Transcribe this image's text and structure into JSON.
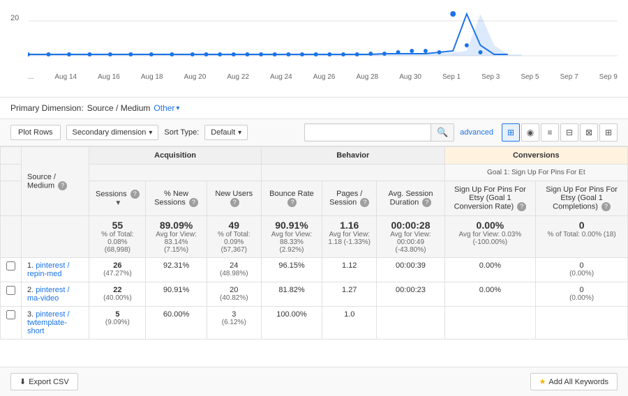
{
  "chart": {
    "y_label": "20",
    "x_labels": [
      "...",
      "Aug 14",
      "Aug 16",
      "Aug 18",
      "Aug 20",
      "Aug 22",
      "Aug 24",
      "Aug 26",
      "Aug 28",
      "Aug 30",
      "Sep 1",
      "Sep 3",
      "Sep 5",
      "Sep 7",
      "Sep 9"
    ]
  },
  "primary_dimension": {
    "label": "Primary Dimension:",
    "value": "Source / Medium",
    "other_label": "Other"
  },
  "toolbar": {
    "plot_rows": "Plot Rows",
    "secondary_dimension": "Secondary dimension",
    "sort_type_label": "Sort Type:",
    "sort_default": "Default",
    "search_placeholder": "",
    "advanced_label": "advanced",
    "view_icons": [
      "⊞",
      "◉",
      "≡",
      "⊟",
      "⊠",
      "⊞"
    ]
  },
  "table": {
    "headers": {
      "source_medium": "Source / Medium",
      "acquisition_group": "Acquisition",
      "behavior_group": "Behavior",
      "conversions_group": "Conversions",
      "goal_label": "Goal 1: Sign Up For Pins For Et",
      "sessions": "Sessions",
      "pct_new_sessions": "% New Sessions",
      "new_users": "New Users",
      "bounce_rate": "Bounce Rate",
      "pages_session": "Pages / Session",
      "avg_session_duration": "Avg. Session Duration",
      "sign_up_rate": "Sign Up For Pins For Etsy (Goal 1 Conversion Rate)",
      "sign_up_completions": "Sign Up For Pins For Etsy (Goal 1 Completions)"
    },
    "total_row": {
      "sessions": "55",
      "sessions_sub": "% of Total: 0.08% (68,998)",
      "pct_new_sessions": "89.09%",
      "pct_new_sessions_sub": "Avg for View: 83.14% (7.15%)",
      "new_users": "49",
      "new_users_sub": "% of Total: 0.09% (57,367)",
      "bounce_rate": "90.91%",
      "bounce_rate_sub": "Avg for View: 88.33% (2.92%)",
      "pages_session": "1.16",
      "pages_session_sub": "Avg for View: 1.18 (-1.33%)",
      "avg_session_duration": "00:00:28",
      "avg_session_duration_sub": "Avg for View: 00:00:49 (-43.80%)",
      "sign_up_rate": "0.00%",
      "sign_up_rate_sub": "Avg for View: 0.03% (-100.00%)",
      "sign_up_completions": "0",
      "sign_up_completions_sub": "% of Total: 0.00% (18)"
    },
    "rows": [
      {
        "num": "1.",
        "source": "pinterest / repin-med",
        "sessions": "26",
        "sessions_sub": "(47.27%)",
        "pct_new_sessions": "92.31%",
        "new_users": "24",
        "new_users_sub": "(48.98%)",
        "bounce_rate": "96.15%",
        "pages_session": "1.12",
        "avg_session_duration": "00:00:39",
        "sign_up_rate": "0.00%",
        "sign_up_completions": "0",
        "sign_up_completions_sub": "(0.00%)"
      },
      {
        "num": "2.",
        "source": "pinterest / ma-video",
        "sessions": "22",
        "sessions_sub": "(40.00%)",
        "pct_new_sessions": "90.91%",
        "new_users": "20",
        "new_users_sub": "(40.82%)",
        "bounce_rate": "81.82%",
        "pages_session": "1.27",
        "avg_session_duration": "00:00:23",
        "sign_up_rate": "0.00%",
        "sign_up_completions": "0",
        "sign_up_completions_sub": "(0.00%)"
      },
      {
        "num": "3.",
        "source": "pinterest / twtemplate-short",
        "sessions": "5",
        "sessions_sub": "(9.09%)",
        "pct_new_sessions": "60.00%",
        "new_users": "3",
        "new_users_sub": "(6.12%)",
        "bounce_rate": "100.00%",
        "pages_session": "1.0",
        "avg_session_duration": "",
        "sign_up_rate": "",
        "sign_up_completions": ""
      }
    ]
  },
  "bottom_bar": {
    "export_label": "Export CSV",
    "add_keywords_label": "Add All Keywords"
  }
}
